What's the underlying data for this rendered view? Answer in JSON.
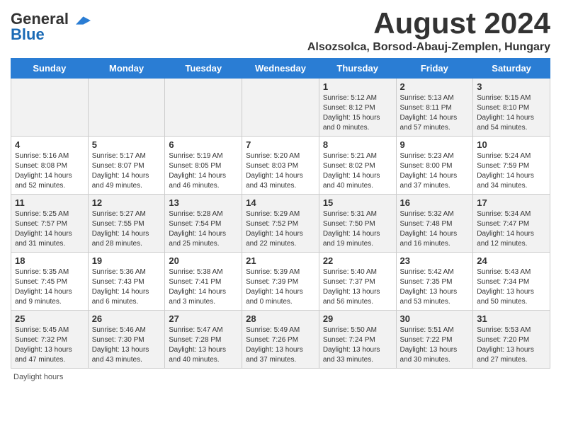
{
  "header": {
    "logo_general": "General",
    "logo_blue": "Blue",
    "month_title": "August 2024",
    "location": "Alsozsolca, Borsod-Abauj-Zemplen, Hungary"
  },
  "weekdays": [
    "Sunday",
    "Monday",
    "Tuesday",
    "Wednesday",
    "Thursday",
    "Friday",
    "Saturday"
  ],
  "footer": {
    "daylight_label": "Daylight hours"
  },
  "weeks": [
    [
      {
        "day": "",
        "info": ""
      },
      {
        "day": "",
        "info": ""
      },
      {
        "day": "",
        "info": ""
      },
      {
        "day": "",
        "info": ""
      },
      {
        "day": "1",
        "info": "Sunrise: 5:12 AM\nSunset: 8:12 PM\nDaylight: 15 hours and 0 minutes."
      },
      {
        "day": "2",
        "info": "Sunrise: 5:13 AM\nSunset: 8:11 PM\nDaylight: 14 hours and 57 minutes."
      },
      {
        "day": "3",
        "info": "Sunrise: 5:15 AM\nSunset: 8:10 PM\nDaylight: 14 hours and 54 minutes."
      }
    ],
    [
      {
        "day": "4",
        "info": "Sunrise: 5:16 AM\nSunset: 8:08 PM\nDaylight: 14 hours and 52 minutes."
      },
      {
        "day": "5",
        "info": "Sunrise: 5:17 AM\nSunset: 8:07 PM\nDaylight: 14 hours and 49 minutes."
      },
      {
        "day": "6",
        "info": "Sunrise: 5:19 AM\nSunset: 8:05 PM\nDaylight: 14 hours and 46 minutes."
      },
      {
        "day": "7",
        "info": "Sunrise: 5:20 AM\nSunset: 8:03 PM\nDaylight: 14 hours and 43 minutes."
      },
      {
        "day": "8",
        "info": "Sunrise: 5:21 AM\nSunset: 8:02 PM\nDaylight: 14 hours and 40 minutes."
      },
      {
        "day": "9",
        "info": "Sunrise: 5:23 AM\nSunset: 8:00 PM\nDaylight: 14 hours and 37 minutes."
      },
      {
        "day": "10",
        "info": "Sunrise: 5:24 AM\nSunset: 7:59 PM\nDaylight: 14 hours and 34 minutes."
      }
    ],
    [
      {
        "day": "11",
        "info": "Sunrise: 5:25 AM\nSunset: 7:57 PM\nDaylight: 14 hours and 31 minutes."
      },
      {
        "day": "12",
        "info": "Sunrise: 5:27 AM\nSunset: 7:55 PM\nDaylight: 14 hours and 28 minutes."
      },
      {
        "day": "13",
        "info": "Sunrise: 5:28 AM\nSunset: 7:54 PM\nDaylight: 14 hours and 25 minutes."
      },
      {
        "day": "14",
        "info": "Sunrise: 5:29 AM\nSunset: 7:52 PM\nDaylight: 14 hours and 22 minutes."
      },
      {
        "day": "15",
        "info": "Sunrise: 5:31 AM\nSunset: 7:50 PM\nDaylight: 14 hours and 19 minutes."
      },
      {
        "day": "16",
        "info": "Sunrise: 5:32 AM\nSunset: 7:48 PM\nDaylight: 14 hours and 16 minutes."
      },
      {
        "day": "17",
        "info": "Sunrise: 5:34 AM\nSunset: 7:47 PM\nDaylight: 14 hours and 12 minutes."
      }
    ],
    [
      {
        "day": "18",
        "info": "Sunrise: 5:35 AM\nSunset: 7:45 PM\nDaylight: 14 hours and 9 minutes."
      },
      {
        "day": "19",
        "info": "Sunrise: 5:36 AM\nSunset: 7:43 PM\nDaylight: 14 hours and 6 minutes."
      },
      {
        "day": "20",
        "info": "Sunrise: 5:38 AM\nSunset: 7:41 PM\nDaylight: 14 hours and 3 minutes."
      },
      {
        "day": "21",
        "info": "Sunrise: 5:39 AM\nSunset: 7:39 PM\nDaylight: 14 hours and 0 minutes."
      },
      {
        "day": "22",
        "info": "Sunrise: 5:40 AM\nSunset: 7:37 PM\nDaylight: 13 hours and 56 minutes."
      },
      {
        "day": "23",
        "info": "Sunrise: 5:42 AM\nSunset: 7:35 PM\nDaylight: 13 hours and 53 minutes."
      },
      {
        "day": "24",
        "info": "Sunrise: 5:43 AM\nSunset: 7:34 PM\nDaylight: 13 hours and 50 minutes."
      }
    ],
    [
      {
        "day": "25",
        "info": "Sunrise: 5:45 AM\nSunset: 7:32 PM\nDaylight: 13 hours and 47 minutes."
      },
      {
        "day": "26",
        "info": "Sunrise: 5:46 AM\nSunset: 7:30 PM\nDaylight: 13 hours and 43 minutes."
      },
      {
        "day": "27",
        "info": "Sunrise: 5:47 AM\nSunset: 7:28 PM\nDaylight: 13 hours and 40 minutes."
      },
      {
        "day": "28",
        "info": "Sunrise: 5:49 AM\nSunset: 7:26 PM\nDaylight: 13 hours and 37 minutes."
      },
      {
        "day": "29",
        "info": "Sunrise: 5:50 AM\nSunset: 7:24 PM\nDaylight: 13 hours and 33 minutes."
      },
      {
        "day": "30",
        "info": "Sunrise: 5:51 AM\nSunset: 7:22 PM\nDaylight: 13 hours and 30 minutes."
      },
      {
        "day": "31",
        "info": "Sunrise: 5:53 AM\nSunset: 7:20 PM\nDaylight: 13 hours and 27 minutes."
      }
    ]
  ]
}
